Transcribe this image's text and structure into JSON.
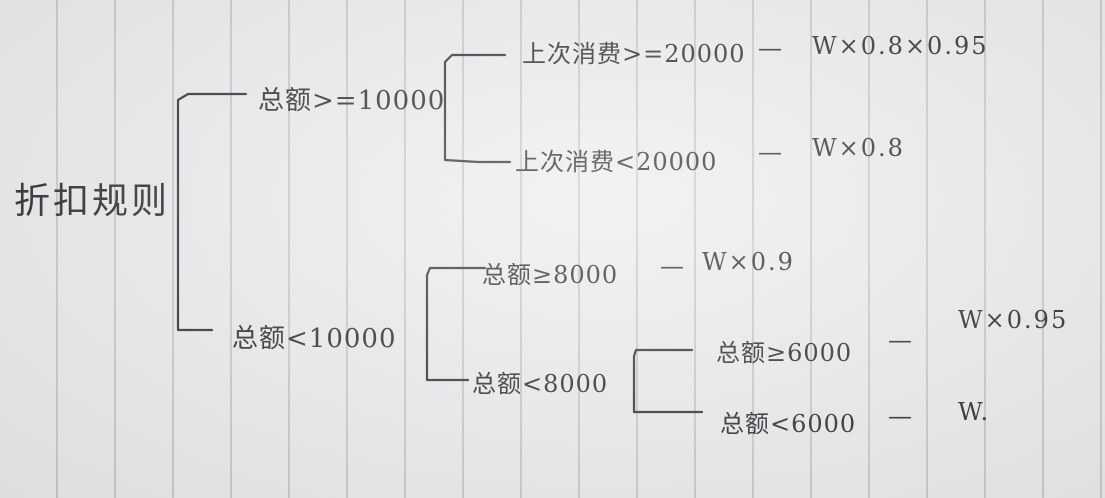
{
  "root": "折扣规则",
  "branches": {
    "high": {
      "condition": "总额>=10000",
      "children": [
        {
          "condition": "上次消费>=20000",
          "sep": "—",
          "result": "W×0.8×0.95"
        },
        {
          "condition": "上次消费<20000",
          "sep": "—",
          "result": "W×0.8"
        }
      ]
    },
    "low": {
      "condition": "总额<10000",
      "children": [
        {
          "condition": "总额≥8000",
          "sep": "—",
          "result": "W×0.9"
        },
        {
          "condition": "总额<8000",
          "children": [
            {
              "condition": "总额≥6000",
              "sep": "—",
              "result": "W×0.95"
            },
            {
              "condition": "总额<6000",
              "sep": "—",
              "result": "W."
            }
          ]
        }
      ]
    }
  }
}
